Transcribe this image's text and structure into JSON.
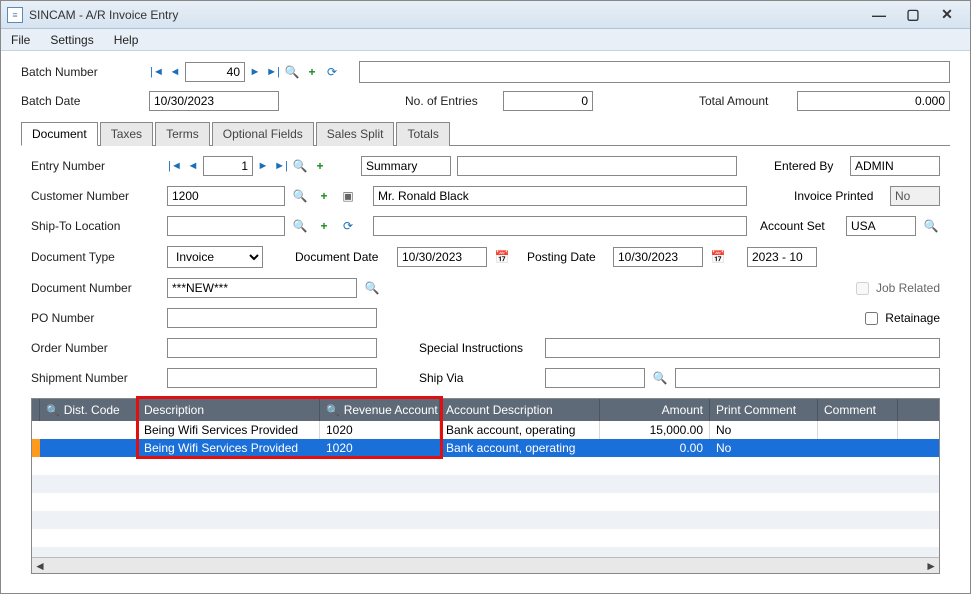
{
  "window": {
    "title": "SINCAM - A/R Invoice Entry"
  },
  "menu": {
    "file": "File",
    "settings": "Settings",
    "help": "Help"
  },
  "header": {
    "batch_number_label": "Batch Number",
    "batch_number": "40",
    "batch_date_label": "Batch Date",
    "batch_date": "10/30/2023",
    "entries_label": "No. of Entries",
    "entries": "0",
    "total_label": "Total Amount",
    "total": "0.000"
  },
  "tabs": {
    "doc": "Document",
    "taxes": "Taxes",
    "terms": "Terms",
    "opt": "Optional Fields",
    "split": "Sales Split",
    "totals": "Totals"
  },
  "doc": {
    "entry_label": "Entry Number",
    "entry": "1",
    "summary_label": "Summary",
    "summary": "",
    "entered_by_label": "Entered By",
    "entered_by": "ADMIN",
    "customer_label": "Customer Number",
    "customer": "1200",
    "customer_name": "Mr. Ronald Black",
    "invoice_printed_label": "Invoice Printed",
    "invoice_printed": "No",
    "shipto_label": "Ship-To Location",
    "shipto": "",
    "account_set_label": "Account Set",
    "account_set": "USA",
    "doctype_label": "Document Type",
    "doctype": "Invoice",
    "docdate_label": "Document Date",
    "docdate": "10/30/2023",
    "postdate_label": "Posting Date",
    "postdate": "10/30/2023",
    "fiscal": "2023 - 10",
    "docnum_label": "Document Number",
    "docnum": "***NEW***",
    "job_label": "Job Related",
    "po_label": "PO Number",
    "po": "",
    "retainage_label": "Retainage",
    "order_label": "Order Number",
    "order": "",
    "special_label": "Special Instructions",
    "special": "",
    "shipment_label": "Shipment Number",
    "shipment": "",
    "shipvia_label": "Ship Via",
    "shipvia_code": "",
    "shipvia_desc": ""
  },
  "grid": {
    "cols": {
      "dist": "Dist. Code",
      "desc": "Description",
      "rev": "Revenue Account",
      "acc": "Account Description",
      "amt": "Amount",
      "prt": "Print Comment",
      "com": "Comment"
    },
    "rows": [
      {
        "dist": "",
        "desc": "Being Wifi Services Provided",
        "rev": "1020",
        "acc": "Bank account, operating",
        "amt": "15,000.00",
        "prt": "No",
        "com": ""
      },
      {
        "dist": "",
        "desc": "Being Wifi Services Provided",
        "rev": "1020",
        "acc": "Bank account, operating",
        "amt": "0.00",
        "prt": "No",
        "com": ""
      }
    ]
  },
  "icons": {
    "first": "|◄",
    "prev": "◄",
    "next": "►",
    "last": "►|",
    "search": "🔍",
    "plus": "+",
    "refresh": "⟳",
    "cal": "📅",
    "arrow": "►",
    "drill": "▣"
  }
}
